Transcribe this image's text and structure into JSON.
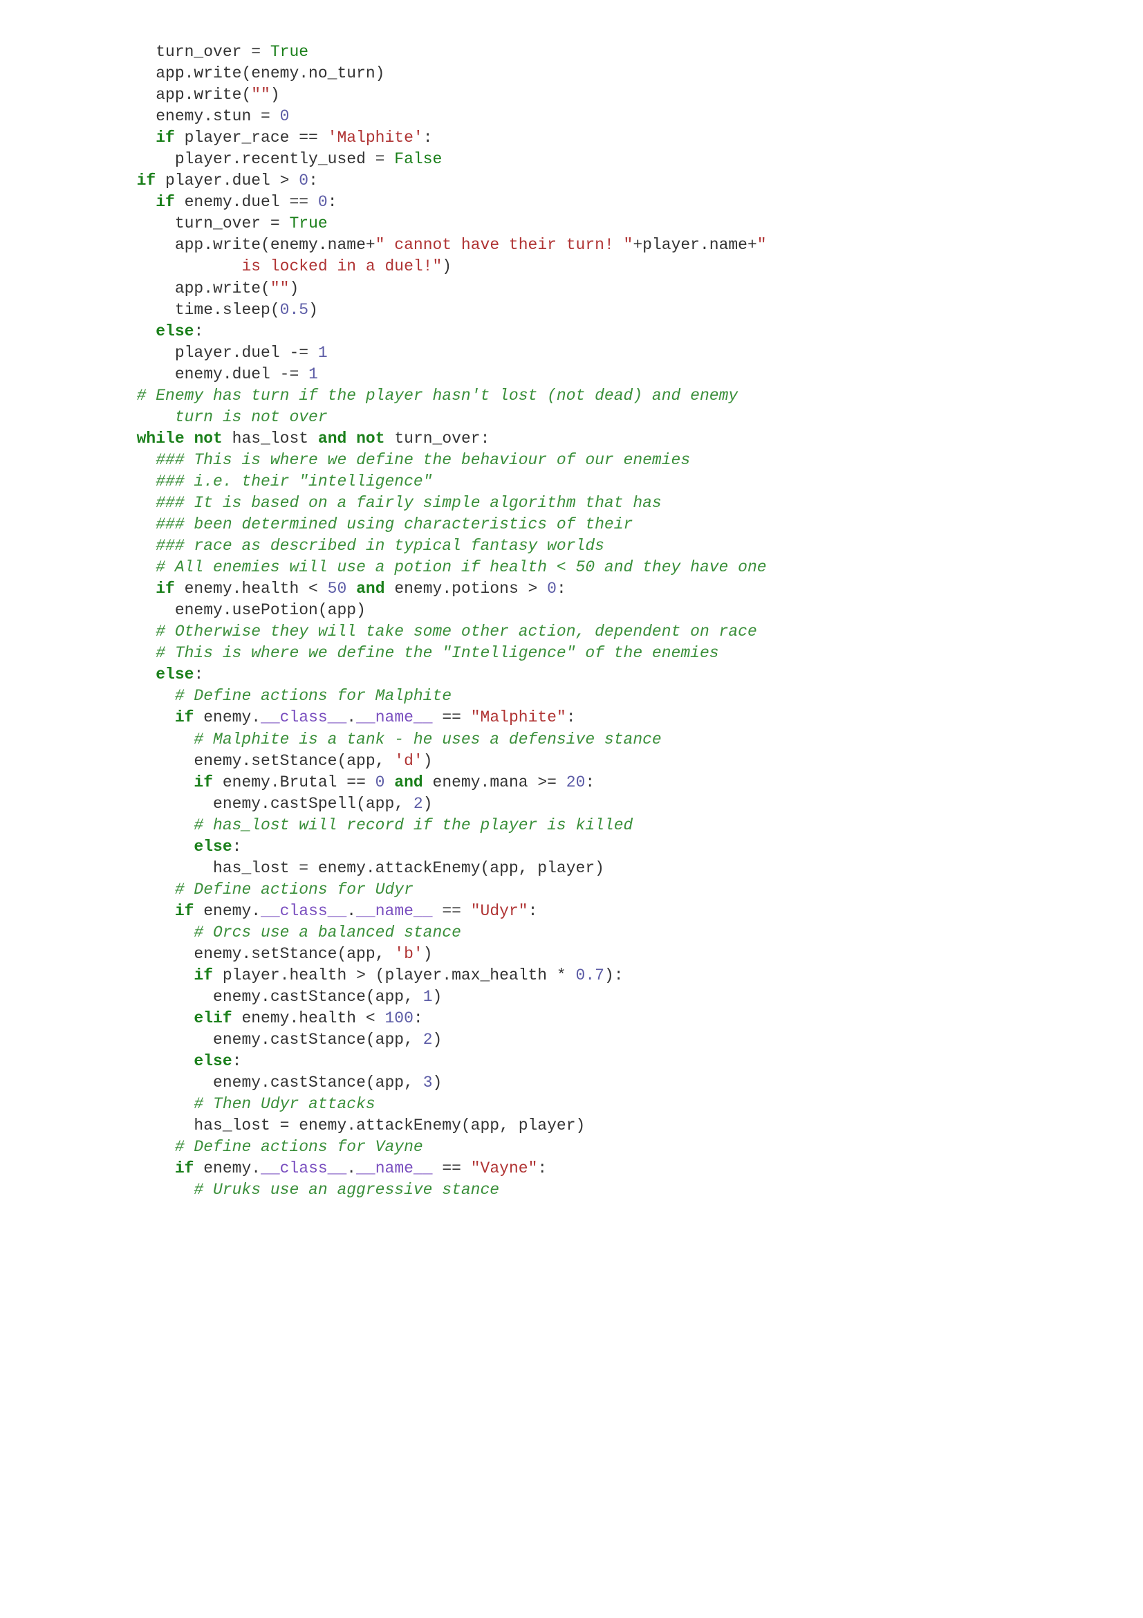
{
  "code_lines": [
    {
      "indent": 2,
      "tokens": [
        {
          "t": "p",
          "s": "turn_over = "
        },
        {
          "t": "bi",
          "s": "True"
        }
      ]
    },
    {
      "indent": 2,
      "tokens": [
        {
          "t": "p",
          "s": "app.write(enemy.no_turn)"
        }
      ]
    },
    {
      "indent": 2,
      "tokens": [
        {
          "t": "p",
          "s": "app.write("
        },
        {
          "t": "str",
          "s": "\"\""
        },
        {
          "t": "p",
          "s": ")"
        }
      ]
    },
    {
      "indent": 2,
      "tokens": [
        {
          "t": "p",
          "s": "enemy.stun = "
        },
        {
          "t": "num",
          "s": "0"
        }
      ]
    },
    {
      "indent": 2,
      "tokens": [
        {
          "t": "kw",
          "s": "if"
        },
        {
          "t": "p",
          "s": " player_race == "
        },
        {
          "t": "str",
          "s": "'Malphite'"
        },
        {
          "t": "p",
          "s": ":"
        }
      ]
    },
    {
      "indent": 3,
      "tokens": [
        {
          "t": "p",
          "s": "player.recently_used = "
        },
        {
          "t": "bi",
          "s": "False"
        }
      ]
    },
    {
      "indent": 0,
      "tokens": [
        {
          "t": "p",
          "s": ""
        }
      ]
    },
    {
      "indent": 1,
      "tokens": [
        {
          "t": "kw",
          "s": "if"
        },
        {
          "t": "p",
          "s": " player.duel > "
        },
        {
          "t": "num",
          "s": "0"
        },
        {
          "t": "p",
          "s": ":"
        }
      ]
    },
    {
      "indent": 2,
      "tokens": [
        {
          "t": "kw",
          "s": "if"
        },
        {
          "t": "p",
          "s": " enemy.duel == "
        },
        {
          "t": "num",
          "s": "0"
        },
        {
          "t": "p",
          "s": ":"
        }
      ]
    },
    {
      "indent": 3,
      "tokens": [
        {
          "t": "p",
          "s": "turn_over = "
        },
        {
          "t": "bi",
          "s": "True"
        }
      ]
    },
    {
      "indent": 3,
      "tokens": [
        {
          "t": "p",
          "s": "app.write(enemy.name+"
        },
        {
          "t": "str",
          "s": "\" cannot have their turn! \""
        },
        {
          "t": "p",
          "s": "+player.name+"
        },
        {
          "t": "str",
          "s": "\""
        }
      ]
    },
    {
      "indent": 6,
      "tokens": [
        {
          "t": "str",
          "s": " is locked in a duel!\""
        },
        {
          "t": "p",
          "s": ")"
        }
      ]
    },
    {
      "indent": 3,
      "tokens": [
        {
          "t": "p",
          "s": "app.write("
        },
        {
          "t": "str",
          "s": "\"\""
        },
        {
          "t": "p",
          "s": ")"
        }
      ]
    },
    {
      "indent": 3,
      "tokens": [
        {
          "t": "p",
          "s": "time.sleep("
        },
        {
          "t": "num",
          "s": "0.5"
        },
        {
          "t": "p",
          "s": ")"
        }
      ]
    },
    {
      "indent": 2,
      "tokens": [
        {
          "t": "kw",
          "s": "else"
        },
        {
          "t": "p",
          "s": ":"
        }
      ]
    },
    {
      "indent": 3,
      "tokens": [
        {
          "t": "p",
          "s": "player.duel -= "
        },
        {
          "t": "num",
          "s": "1"
        }
      ]
    },
    {
      "indent": 3,
      "tokens": [
        {
          "t": "p",
          "s": "enemy.duel -= "
        },
        {
          "t": "num",
          "s": "1"
        }
      ]
    },
    {
      "indent": 0,
      "tokens": [
        {
          "t": "p",
          "s": ""
        }
      ]
    },
    {
      "indent": 1,
      "tokens": [
        {
          "t": "cmt",
          "s": "# Enemy has turn if the player hasn't lost (not dead) and enemy"
        }
      ]
    },
    {
      "indent": 3,
      "tokens": [
        {
          "t": "cmt",
          "s": "turn is not over"
        }
      ]
    },
    {
      "indent": 1,
      "tokens": [
        {
          "t": "kw",
          "s": "while"
        },
        {
          "t": "p",
          "s": " "
        },
        {
          "t": "kw",
          "s": "not"
        },
        {
          "t": "p",
          "s": " has_lost "
        },
        {
          "t": "kw",
          "s": "and"
        },
        {
          "t": "p",
          "s": " "
        },
        {
          "t": "kw",
          "s": "not"
        },
        {
          "t": "p",
          "s": " turn_over:"
        }
      ]
    },
    {
      "indent": 0,
      "tokens": [
        {
          "t": "p",
          "s": ""
        }
      ]
    },
    {
      "indent": 2,
      "tokens": [
        {
          "t": "cmt",
          "s": "### This is where we define the behaviour of our enemies"
        }
      ]
    },
    {
      "indent": 2,
      "tokens": [
        {
          "t": "cmt",
          "s": "### i.e. their \"intelligence\""
        }
      ]
    },
    {
      "indent": 2,
      "tokens": [
        {
          "t": "cmt",
          "s": "### It is based on a fairly simple algorithm that has"
        }
      ]
    },
    {
      "indent": 2,
      "tokens": [
        {
          "t": "cmt",
          "s": "### been determined using characteristics of their"
        }
      ]
    },
    {
      "indent": 2,
      "tokens": [
        {
          "t": "cmt",
          "s": "### race as described in typical fantasy worlds"
        }
      ]
    },
    {
      "indent": 2,
      "tokens": [
        {
          "t": "cmt",
          "s": "# All enemies will use a potion if health < 50 and they have one"
        }
      ]
    },
    {
      "indent": 2,
      "tokens": [
        {
          "t": "kw",
          "s": "if"
        },
        {
          "t": "p",
          "s": " enemy.health < "
        },
        {
          "t": "num",
          "s": "50"
        },
        {
          "t": "p",
          "s": " "
        },
        {
          "t": "kw",
          "s": "and"
        },
        {
          "t": "p",
          "s": " enemy.potions > "
        },
        {
          "t": "num",
          "s": "0"
        },
        {
          "t": "p",
          "s": ":"
        }
      ]
    },
    {
      "indent": 3,
      "tokens": [
        {
          "t": "p",
          "s": "enemy.usePotion(app)"
        }
      ]
    },
    {
      "indent": 0,
      "tokens": [
        {
          "t": "p",
          "s": ""
        }
      ]
    },
    {
      "indent": 2,
      "tokens": [
        {
          "t": "cmt",
          "s": "# Otherwise they will take some other action, dependent on race"
        }
      ]
    },
    {
      "indent": 2,
      "tokens": [
        {
          "t": "cmt",
          "s": "# This is where we define the \"Intelligence\" of the enemies"
        }
      ]
    },
    {
      "indent": 2,
      "tokens": [
        {
          "t": "kw",
          "s": "else"
        },
        {
          "t": "p",
          "s": ":"
        }
      ]
    },
    {
      "indent": 3,
      "tokens": [
        {
          "t": "cmt",
          "s": "# Define actions for Malphite"
        }
      ]
    },
    {
      "indent": 3,
      "tokens": [
        {
          "t": "kw",
          "s": "if"
        },
        {
          "t": "p",
          "s": " enemy."
        },
        {
          "t": "sp",
          "s": "__class__"
        },
        {
          "t": "p",
          "s": "."
        },
        {
          "t": "sp",
          "s": "__name__"
        },
        {
          "t": "p",
          "s": " == "
        },
        {
          "t": "str",
          "s": "\"Malphite\""
        },
        {
          "t": "p",
          "s": ":"
        }
      ]
    },
    {
      "indent": 4,
      "tokens": [
        {
          "t": "cmt",
          "s": "# Malphite is a tank - he uses a defensive stance"
        }
      ]
    },
    {
      "indent": 4,
      "tokens": [
        {
          "t": "p",
          "s": "enemy.setStance(app, "
        },
        {
          "t": "str",
          "s": "'d'"
        },
        {
          "t": "p",
          "s": ")"
        }
      ]
    },
    {
      "indent": 4,
      "tokens": [
        {
          "t": "kw",
          "s": "if"
        },
        {
          "t": "p",
          "s": " enemy.Brutal == "
        },
        {
          "t": "num",
          "s": "0"
        },
        {
          "t": "p",
          "s": " "
        },
        {
          "t": "kw",
          "s": "and"
        },
        {
          "t": "p",
          "s": " enemy.mana >= "
        },
        {
          "t": "num",
          "s": "20"
        },
        {
          "t": "p",
          "s": ":"
        }
      ]
    },
    {
      "indent": 5,
      "tokens": [
        {
          "t": "p",
          "s": "enemy.castSpell(app, "
        },
        {
          "t": "num",
          "s": "2"
        },
        {
          "t": "p",
          "s": ")"
        }
      ]
    },
    {
      "indent": 4,
      "tokens": [
        {
          "t": "cmt",
          "s": "# has_lost will record if the player is killed"
        }
      ]
    },
    {
      "indent": 4,
      "tokens": [
        {
          "t": "kw",
          "s": "else"
        },
        {
          "t": "p",
          "s": ":"
        }
      ]
    },
    {
      "indent": 5,
      "tokens": [
        {
          "t": "p",
          "s": "has_lost = enemy.attackEnemy(app, player)"
        }
      ]
    },
    {
      "indent": 0,
      "tokens": [
        {
          "t": "p",
          "s": ""
        }
      ]
    },
    {
      "indent": 3,
      "tokens": [
        {
          "t": "cmt",
          "s": "# Define actions for Udyr"
        }
      ]
    },
    {
      "indent": 3,
      "tokens": [
        {
          "t": "kw",
          "s": "if"
        },
        {
          "t": "p",
          "s": " enemy."
        },
        {
          "t": "sp",
          "s": "__class__"
        },
        {
          "t": "p",
          "s": "."
        },
        {
          "t": "sp",
          "s": "__name__"
        },
        {
          "t": "p",
          "s": " == "
        },
        {
          "t": "str",
          "s": "\"Udyr\""
        },
        {
          "t": "p",
          "s": ":"
        }
      ]
    },
    {
      "indent": 4,
      "tokens": [
        {
          "t": "cmt",
          "s": "# Orcs use a balanced stance"
        }
      ]
    },
    {
      "indent": 4,
      "tokens": [
        {
          "t": "p",
          "s": "enemy.setStance(app, "
        },
        {
          "t": "str",
          "s": "'b'"
        },
        {
          "t": "p",
          "s": ")"
        }
      ]
    },
    {
      "indent": 4,
      "tokens": [
        {
          "t": "kw",
          "s": "if"
        },
        {
          "t": "p",
          "s": " player.health > (player.max_health * "
        },
        {
          "t": "num",
          "s": "0.7"
        },
        {
          "t": "p",
          "s": "):"
        }
      ]
    },
    {
      "indent": 5,
      "tokens": [
        {
          "t": "p",
          "s": "enemy.castStance(app, "
        },
        {
          "t": "num",
          "s": "1"
        },
        {
          "t": "p",
          "s": ")"
        }
      ]
    },
    {
      "indent": 4,
      "tokens": [
        {
          "t": "kw",
          "s": "elif"
        },
        {
          "t": "p",
          "s": " enemy.health < "
        },
        {
          "t": "num",
          "s": "100"
        },
        {
          "t": "p",
          "s": ":"
        }
      ]
    },
    {
      "indent": 5,
      "tokens": [
        {
          "t": "p",
          "s": "enemy.castStance(app, "
        },
        {
          "t": "num",
          "s": "2"
        },
        {
          "t": "p",
          "s": ")"
        }
      ]
    },
    {
      "indent": 4,
      "tokens": [
        {
          "t": "kw",
          "s": "else"
        },
        {
          "t": "p",
          "s": ":"
        }
      ]
    },
    {
      "indent": 5,
      "tokens": [
        {
          "t": "p",
          "s": "enemy.castStance(app, "
        },
        {
          "t": "num",
          "s": "3"
        },
        {
          "t": "p",
          "s": ")"
        }
      ]
    },
    {
      "indent": 4,
      "tokens": [
        {
          "t": "cmt",
          "s": "# Then Udyr attacks"
        }
      ]
    },
    {
      "indent": 4,
      "tokens": [
        {
          "t": "p",
          "s": "has_lost = enemy.attackEnemy(app, player)"
        }
      ]
    },
    {
      "indent": 0,
      "tokens": [
        {
          "t": "p",
          "s": ""
        }
      ]
    },
    {
      "indent": 3,
      "tokens": [
        {
          "t": "cmt",
          "s": "# Define actions for Vayne"
        }
      ]
    },
    {
      "indent": 3,
      "tokens": [
        {
          "t": "kw",
          "s": "if"
        },
        {
          "t": "p",
          "s": " enemy."
        },
        {
          "t": "sp",
          "s": "__class__"
        },
        {
          "t": "p",
          "s": "."
        },
        {
          "t": "sp",
          "s": "__name__"
        },
        {
          "t": "p",
          "s": " == "
        },
        {
          "t": "str",
          "s": "\"Vayne\""
        },
        {
          "t": "p",
          "s": ":"
        }
      ]
    },
    {
      "indent": 4,
      "tokens": [
        {
          "t": "cmt",
          "s": "# Uruks use an aggressive stance"
        }
      ]
    }
  ],
  "indent_unit": "  ",
  "colors": {
    "keyword": "#1a7f1a",
    "comment": "#3a8f3a",
    "string": "#b03434",
    "number": "#5c5ca6",
    "builtin": "#1a7f1a",
    "special": "#7a4fbf",
    "plain": "#333333"
  }
}
